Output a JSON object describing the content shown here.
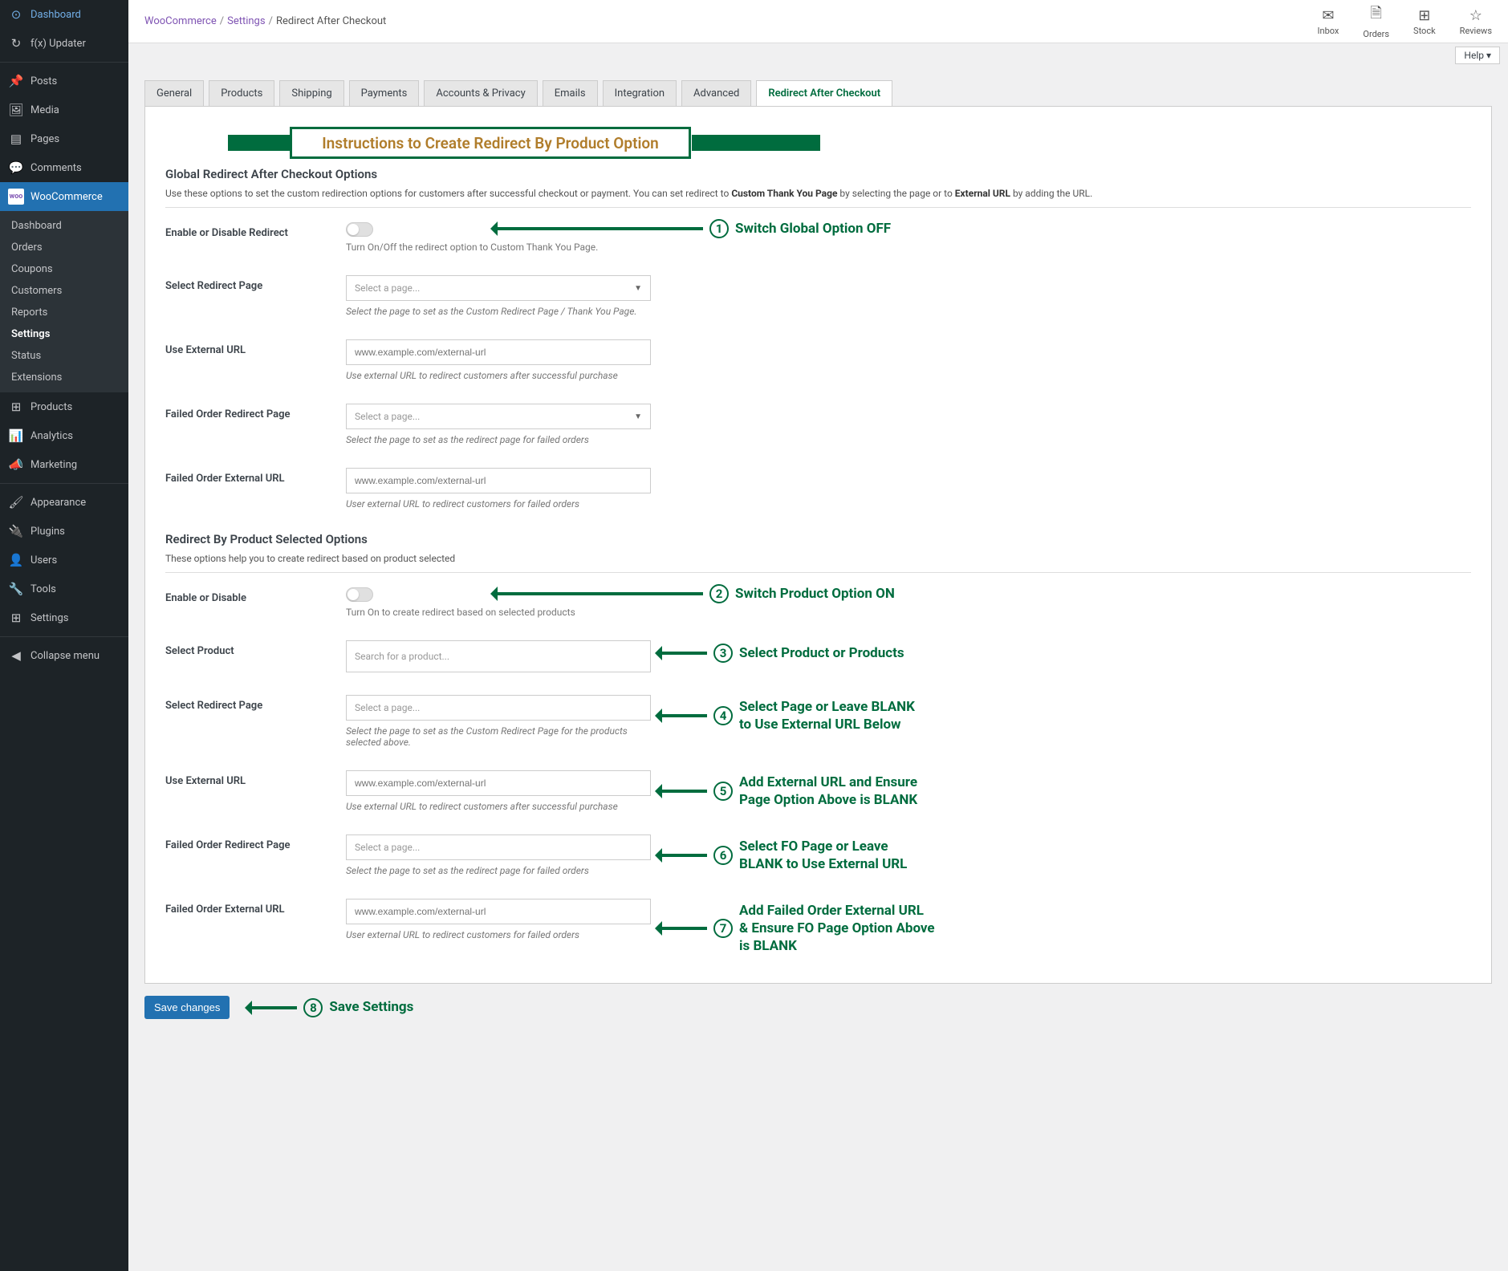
{
  "breadcrumb": {
    "l1": "WooCommerce",
    "l2": "Settings",
    "l3": "Redirect After Checkout"
  },
  "topicons": {
    "inbox": "Inbox",
    "orders": "Orders",
    "stock": "Stock",
    "reviews": "Reviews"
  },
  "help": "Help ▾",
  "sidebar": {
    "dashboard": "Dashboard",
    "updater": "f(x) Updater",
    "posts": "Posts",
    "media": "Media",
    "pages": "Pages",
    "comments": "Comments",
    "woocommerce": "WooCommerce",
    "sub": {
      "dashboard": "Dashboard",
      "orders": "Orders",
      "coupons": "Coupons",
      "customers": "Customers",
      "reports": "Reports",
      "settings": "Settings",
      "status": "Status",
      "extensions": "Extensions"
    },
    "products": "Products",
    "analytics": "Analytics",
    "marketing": "Marketing",
    "appearance": "Appearance",
    "plugins": "Plugins",
    "users": "Users",
    "tools": "Tools",
    "settings2": "Settings",
    "collapse": "Collapse menu"
  },
  "tabs": {
    "general": "General",
    "products": "Products",
    "shipping": "Shipping",
    "payments": "Payments",
    "accounts": "Accounts & Privacy",
    "emails": "Emails",
    "integration": "Integration",
    "advanced": "Advanced",
    "redirect": "Redirect After Checkout"
  },
  "banner": "Instructions to Create  Redirect By Product Option",
  "global": {
    "title": "Global Redirect After Checkout Options",
    "desc1": "Use these options to set the custom redirection options for customers after successful checkout or payment. You can set redirect to ",
    "b1": "Custom Thank You Page",
    "desc2": " by selecting the page or to ",
    "b2": "External URL",
    "desc3": " by adding the URL.",
    "f1": {
      "label": "Enable or Disable Redirect",
      "help": "Turn On/Off the redirect option to Custom Thank You Page."
    },
    "f2": {
      "label": "Select Redirect Page",
      "placeholder": "Select a page...",
      "help": "Select the page to set as the Custom Redirect Page / Thank You Page."
    },
    "f3": {
      "label": "Use External URL",
      "placeholder": "www.example.com/external-url",
      "help": "Use external URL to redirect customers after successful purchase"
    },
    "f4": {
      "label": "Failed Order Redirect Page",
      "placeholder": "Select a page...",
      "help": "Select the page to set as the redirect page for failed orders"
    },
    "f5": {
      "label": "Failed Order External URL",
      "placeholder": "www.example.com/external-url",
      "help": "User external URL to redirect customers for failed orders"
    }
  },
  "product": {
    "title": "Redirect By Product Selected Options",
    "desc": "These options help you to create redirect based on product selected",
    "f1": {
      "label": "Enable or Disable",
      "help": "Turn On to create redirect based on selected products"
    },
    "f2": {
      "label": "Select Product",
      "placeholder": "Search for a product..."
    },
    "f3": {
      "label": "Select Redirect Page",
      "placeholder": "Select a page...",
      "help": "Select the page to set as the Custom Redirect Page for the products selected above."
    },
    "f4": {
      "label": "Use External URL",
      "placeholder": "www.example.com/external-url",
      "help": "Use external URL to redirect customers after successful purchase"
    },
    "f5": {
      "label": "Failed Order Redirect Page",
      "placeholder": "Select a page...",
      "help": "Select the page to set as the redirect page for failed orders"
    },
    "f6": {
      "label": "Failed Order External URL",
      "placeholder": "www.example.com/external-url",
      "help": "User external URL to redirect customers for failed orders"
    }
  },
  "anno": {
    "a1": "Switch Global Option OFF",
    "a2": "Switch Product Option ON",
    "a3": "Select Product or Products",
    "a4a": "Select Page or Leave BLANK",
    "a4b": "to Use External URL Below",
    "a5a": "Add External URL and Ensure",
    "a5b": "Page Option Above is BLANK",
    "a6a": "Select FO Page or Leave",
    "a6b": "BLANK to Use External URL",
    "a7a": "Add Failed Order External URL",
    "a7b": "& Ensure FO Page Option Above",
    "a7c": "is BLANK",
    "a8": "Save Settings"
  },
  "save": "Save changes"
}
